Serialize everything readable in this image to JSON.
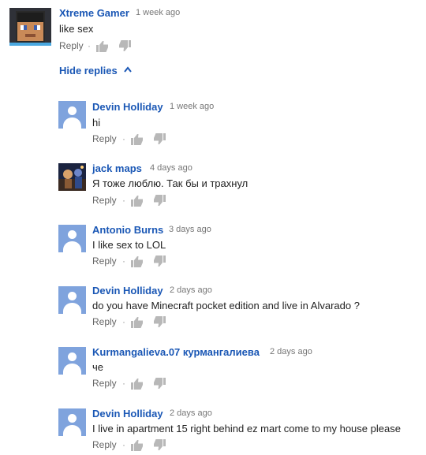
{
  "actions": {
    "reply_label": "Reply",
    "separator": "·",
    "like_icon": "thumbs-up-icon",
    "dislike_icon": "thumbs-down-icon"
  },
  "thread": {
    "hide_replies_label": "Hide replies",
    "chevron_icon": "chevron-up-icon"
  },
  "top_comment": {
    "author": "Xtreme Gamer",
    "time": "1 week ago",
    "text": "like sex",
    "avatar_icon": "minecraft-avatar"
  },
  "replies": [
    {
      "author": "Devin Holliday",
      "time": "1 week ago",
      "text": "hi",
      "avatar_icon": "default-user-icon"
    },
    {
      "author": "jack maps",
      "time": "4 days ago",
      "text": "Я тоже люблю. Так бы и трахнул",
      "avatar_icon": "photo-avatar"
    },
    {
      "author": "Antonio Burns",
      "time": "3 days ago",
      "text": "I like sex to LOL",
      "avatar_icon": "default-user-icon"
    },
    {
      "author": "Devin Holliday",
      "time": "2 days ago",
      "text": "do you have Minecraft pocket edition and live in Alvarado ?",
      "avatar_icon": "default-user-icon"
    },
    {
      "author": "Kurmangalieva.07 курмангалиева",
      "time": "2 days ago",
      "text": "че",
      "avatar_icon": "default-user-icon"
    },
    {
      "author": "Devin Holliday",
      "time": "2 days ago",
      "text": "I live in apartment 15 right behind ez mart come to my house please",
      "avatar_icon": "default-user-icon"
    }
  ],
  "colors": {
    "author_link": "#1a57b5",
    "default_avatar": "#7fa3dd",
    "icon_gray": "#b8b8b8"
  }
}
